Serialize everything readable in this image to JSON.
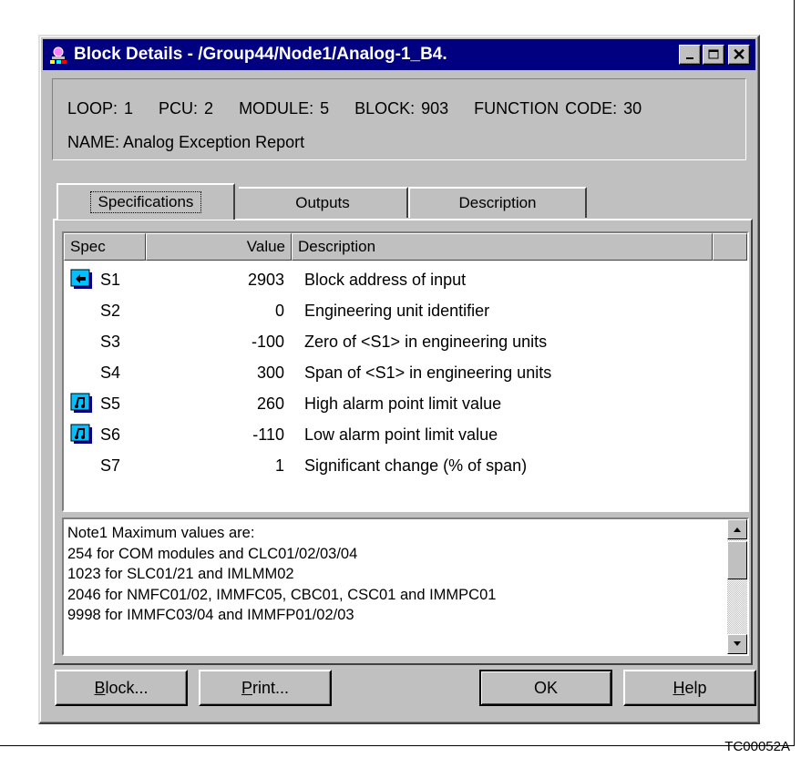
{
  "window": {
    "title": "Block Details - /Group44/Node1/Analog-1_B4.",
    "minimize_icon": "minimize-icon",
    "maximize_icon": "maximize-icon",
    "close_icon": "close-icon",
    "close_glyph": "✕"
  },
  "info": {
    "loop": "LOOP: 1",
    "pcu": "PCU: 2",
    "module": "MODULE: 5",
    "block": "BLOCK: 903",
    "function_code": "FUNCTION CODE: 30",
    "name": "NAME: Analog Exception Report"
  },
  "tabs": [
    {
      "label": "Specifications",
      "active": true
    },
    {
      "label": "Outputs",
      "active": false
    },
    {
      "label": "Description",
      "active": false
    }
  ],
  "grid": {
    "columns": [
      "Spec",
      "Value",
      "Description"
    ],
    "rows": [
      {
        "icon": "input-arrow-icon",
        "spec": "S1",
        "value": "2903",
        "description": "Block address of input"
      },
      {
        "icon": "",
        "spec": "S2",
        "value": "0",
        "description": "Engineering unit identifier"
      },
      {
        "icon": "",
        "spec": "S3",
        "value": "-100",
        "description": "Zero of <S1> in engineering units"
      },
      {
        "icon": "",
        "spec": "S4",
        "value": "300",
        "description": "Span of <S1> in engineering units"
      },
      {
        "icon": "tune-icon",
        "spec": "S5",
        "value": "260",
        "description": "High alarm point limit value"
      },
      {
        "icon": "tune-icon",
        "spec": "S6",
        "value": "-110",
        "description": "Low alarm point limit value"
      },
      {
        "icon": "",
        "spec": "S7",
        "value": "1",
        "description": "Significant change (% of span)"
      }
    ]
  },
  "notes": {
    "lines": [
      "Note1  Maximum values are:",
      "254 for COM modules and CLC01/02/03/04",
      "1023 for SLC01/21 and IMLMM02",
      "2046 for NMFC01/02, IMMFC05, CBC01, CSC01 and IMMPC01",
      "9998 for IMMFC03/04 and IMMFP01/02/03"
    ]
  },
  "buttons": {
    "block": {
      "underline": "B",
      "rest": "lock..."
    },
    "print": {
      "underline": "P",
      "rest": "rint..."
    },
    "ok": "OK",
    "help": {
      "underline": "H",
      "rest": "elp"
    }
  },
  "figure_id": "TC00052A",
  "colors": {
    "titlebar": "#000080",
    "face": "#c0c0c0",
    "icon_fill": "#00c0ff"
  }
}
